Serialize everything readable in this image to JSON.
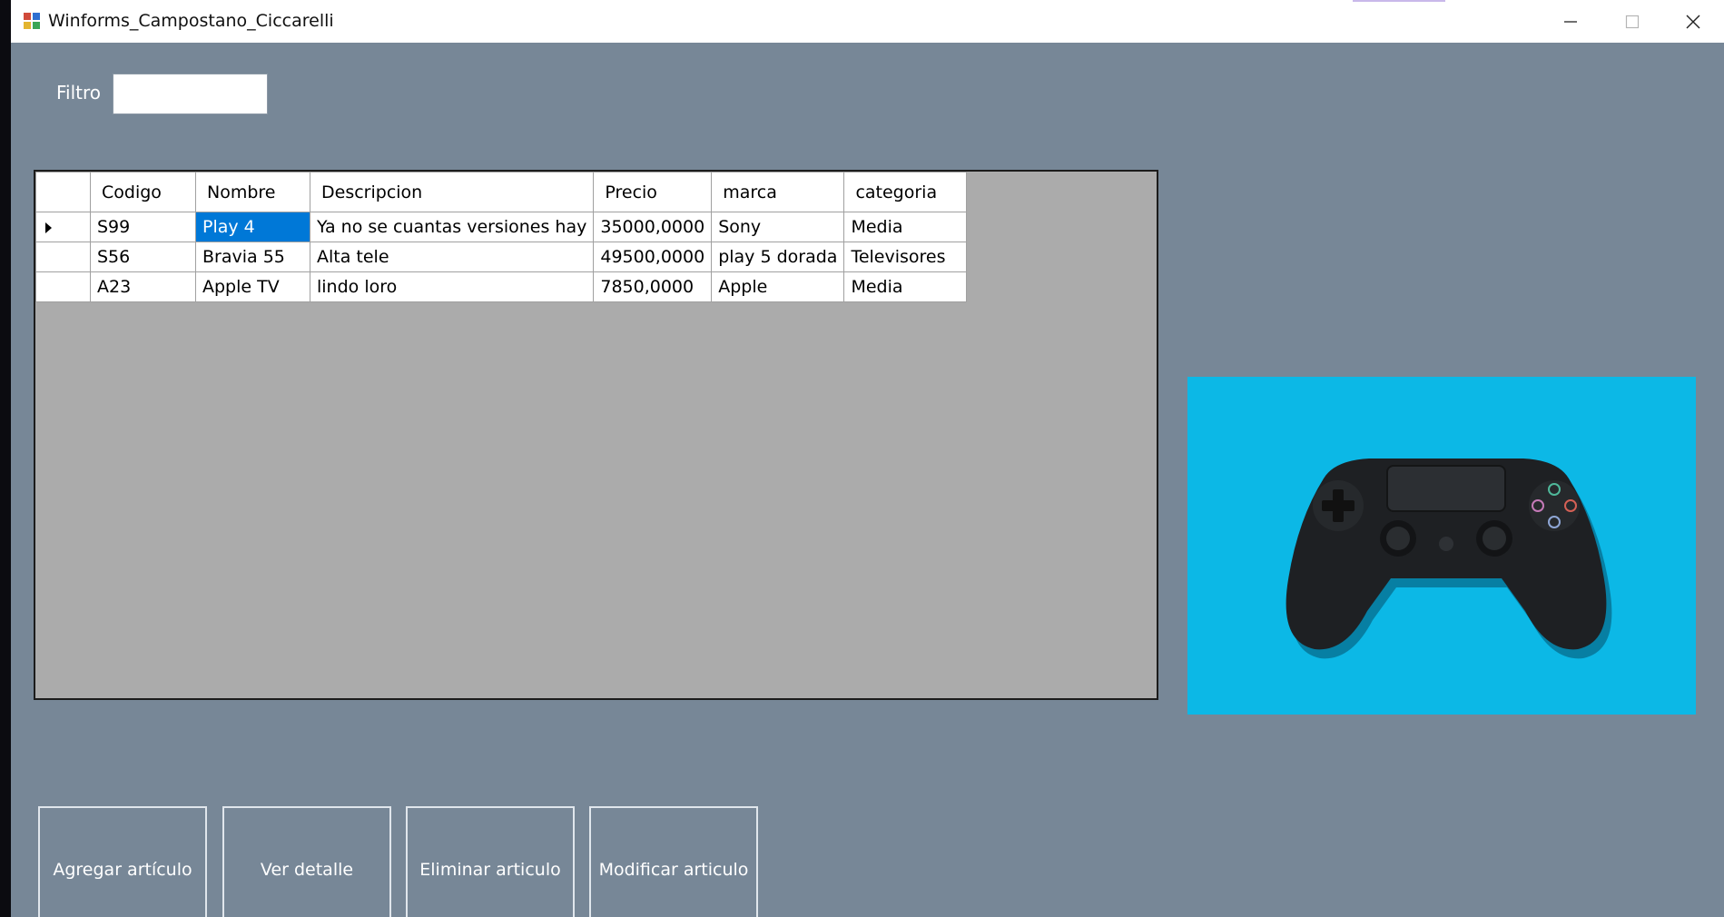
{
  "window": {
    "title": "Winforms_Campostano_Ciccarelli"
  },
  "filter": {
    "label": "Filtro",
    "value": ""
  },
  "grid": {
    "columns": [
      "Codigo",
      "Nombre",
      "Descripcion",
      "Precio",
      "marca",
      "categoria"
    ],
    "rows": [
      [
        "S99",
        "Play 4",
        "Ya no se cuantas versiones hay",
        "35000,0000",
        "Sony",
        "Media"
      ],
      [
        "S56",
        "Bravia 55",
        "Alta tele",
        "49500,0000",
        "play 5 dorada",
        "Televisores"
      ],
      [
        "A23",
        "Apple TV",
        "lindo loro",
        "7850,0000",
        "Apple",
        "Media"
      ]
    ],
    "current_row": 0,
    "selected_cell": "Nombre"
  },
  "image": {
    "subject": "gamepad",
    "background": "#0cb8e6"
  },
  "buttons": {
    "add": "Agregar artículo",
    "detail": "Ver detalle",
    "delete": "Eliminar articulo",
    "modify": "Modificar articulo"
  },
  "colors": {
    "form_background": "#778797",
    "selection": "#0078d7",
    "grid_background": "#ababab"
  }
}
